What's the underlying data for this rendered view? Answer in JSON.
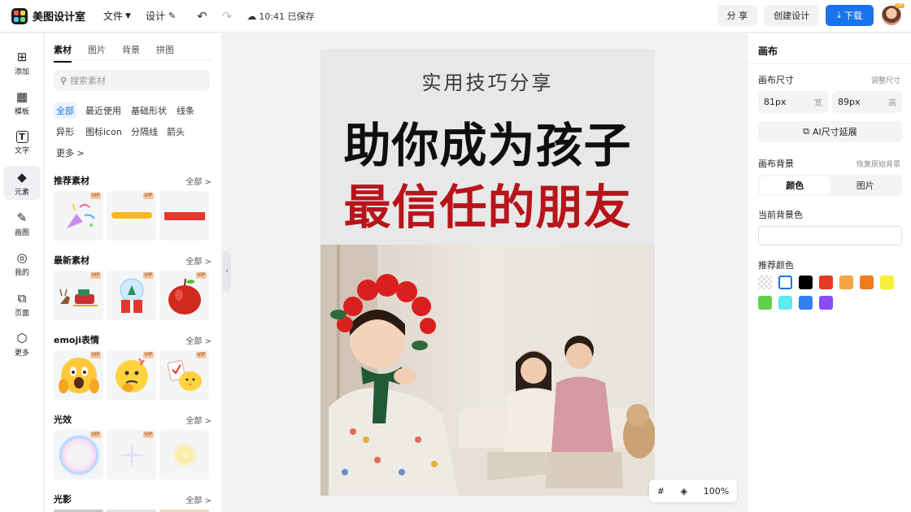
{
  "app": {
    "name": "美图设计室",
    "menus": [
      "文件",
      "设计"
    ],
    "save_status": "10:41 已保存",
    "buttons": {
      "share": "分 享",
      "create": "创建设计",
      "download": "下载"
    },
    "avatar_badge": "VIP"
  },
  "rail": [
    {
      "label": "添加",
      "icon": "add-icon",
      "glyph": "⊞"
    },
    {
      "label": "模板",
      "icon": "template-icon",
      "glyph": "▦"
    },
    {
      "label": "文字",
      "icon": "text-icon",
      "glyph": "T"
    },
    {
      "label": "元素",
      "icon": "element-icon",
      "glyph": "◆",
      "active": true
    },
    {
      "label": "画图",
      "icon": "draw-icon",
      "glyph": "✎"
    },
    {
      "label": "我的",
      "icon": "profile-icon",
      "glyph": "◎"
    },
    {
      "label": "页面",
      "icon": "page-icon",
      "glyph": "⧉"
    },
    {
      "label": "更多",
      "icon": "more-icon",
      "glyph": "⬡"
    }
  ],
  "panel": {
    "tabs": [
      "素材",
      "图片",
      "背景",
      "拼图"
    ],
    "active_tab": "素材",
    "search_placeholder": "搜索素材",
    "chips": [
      "全部",
      "最近使用",
      "基础形状",
      "线条",
      "异形",
      "图标icon",
      "分隔线",
      "箭头",
      "更多 >"
    ],
    "all_label": "全部 >",
    "vip_badge": "VIP",
    "sections": [
      "推荐素材",
      "最新素材",
      "emoji表情",
      "光效",
      "光影"
    ]
  },
  "canvas": {
    "subtitle": "实用技巧分享",
    "title_line1": "助你成为孩子",
    "title_line2": "最信任的朋友",
    "accent_color": "#b8141b",
    "zoom": "100%"
  },
  "right_panel": {
    "title": "画布",
    "size_label": "画布尺寸",
    "size_adjust": "调整尺寸",
    "width_value": "81px",
    "width_unit": "宽",
    "height_value": "89px",
    "height_unit": "高",
    "ai_extend": "AI尺寸延展",
    "bg_label": "画布背景",
    "bg_restore": "恢复原始背景",
    "bg_tabs": [
      "颜色",
      "图片"
    ],
    "current_bg": "当前背景色",
    "recommended": "推荐颜色",
    "swatches": [
      "transparent",
      "#ffffff",
      "#000000",
      "#e53a23",
      "#f2a544",
      "#ef7a1f",
      "#f7ef3c",
      "#5fd149",
      "#5ce9ef",
      "#2f7ff0",
      "#8a4cf2"
    ]
  }
}
